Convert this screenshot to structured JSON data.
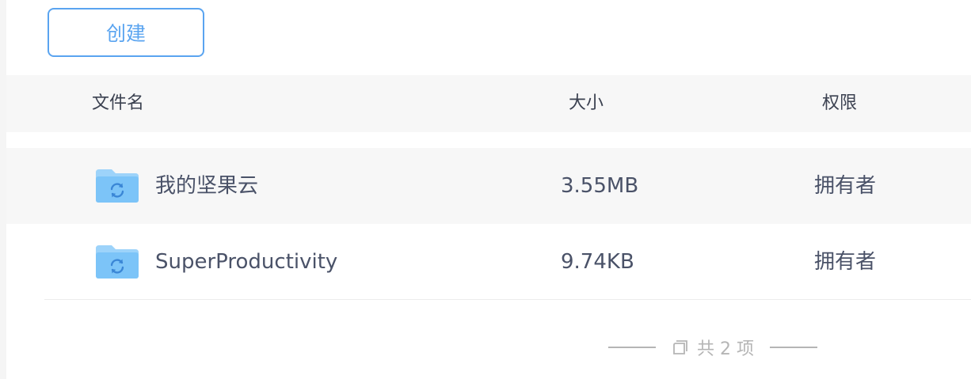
{
  "toolbar": {
    "create_label": "创建"
  },
  "table": {
    "columns": {
      "name": "文件名",
      "size": "大小",
      "permission": "权限"
    },
    "rows": [
      {
        "icon": "sync-folder-icon",
        "name": "我的坚果云",
        "size": "3.55MB",
        "permission": "拥有者"
      },
      {
        "icon": "sync-folder-icon",
        "name": "SuperProductivity",
        "size": "9.74KB",
        "permission": "拥有者"
      }
    ]
  },
  "footer": {
    "icon": "copy-icon",
    "count_text": "共 2 项"
  },
  "colors": {
    "accent": "#5aa4f0",
    "folder": "#7cc4f8",
    "folder_symbol": "#3a86d6",
    "text": "#4a5268",
    "muted": "#b5b5b5"
  }
}
